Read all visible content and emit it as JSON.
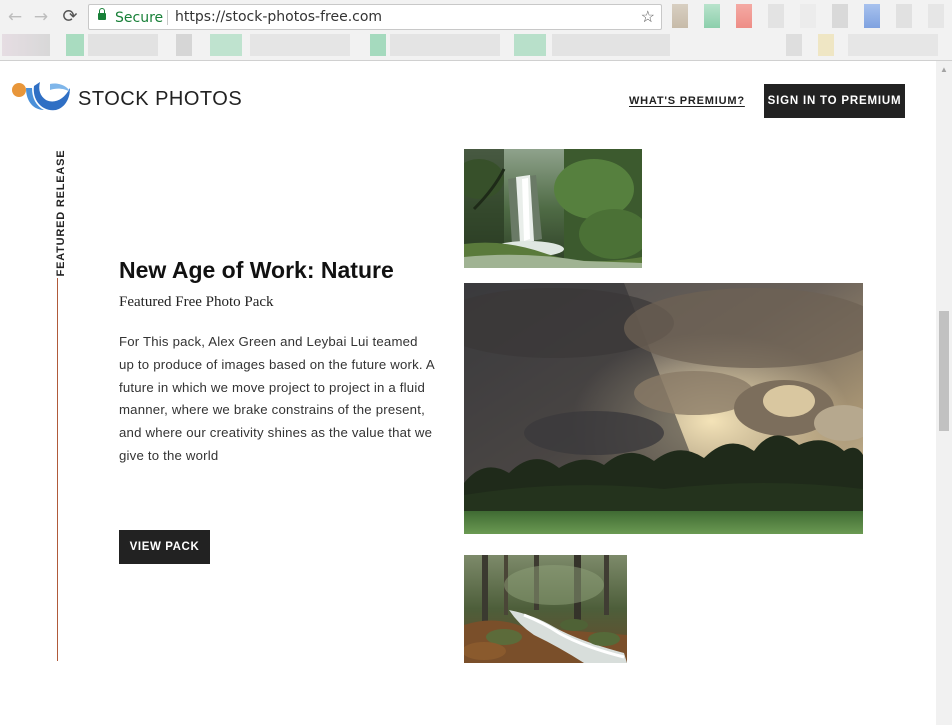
{
  "browser": {
    "secure_label": "Secure",
    "url": "https://stock-photos-free.com",
    "back_icon": "←",
    "forward_icon": "→",
    "reload_icon": "⟳",
    "star_icon": "☆"
  },
  "site": {
    "brand": "STOCK PHOTOS",
    "nav_premium": "WHAT'S PREMIUM?",
    "signin_label": "SIGN IN TO PREMIUM"
  },
  "featured": {
    "label": "FEATURED RELEASE",
    "title": "New Age of Work: Nature",
    "subtitle": "Featured Free Photo Pack",
    "description": "For This pack, Alex Green and Leybai Lui teamed up to produce of images based on the future work. A future in which we move project to project in a fluid manner, where we brake constrains of the present, and where our creativity shines as the value that we give to the world",
    "button_label": "VIEW PACK"
  },
  "photos": [
    {
      "name": "waterfall-photo",
      "subject": "waterfall in a forest"
    },
    {
      "name": "storm-clouds-photo",
      "subject": "storm clouds over a treeline and field"
    },
    {
      "name": "forest-stream-photo",
      "subject": "stream flowing over rocks in an autumn forest"
    }
  ],
  "colors": {
    "accent_line": "#b05a3a",
    "button_bg": "#222222",
    "secure_green": "#188038"
  }
}
